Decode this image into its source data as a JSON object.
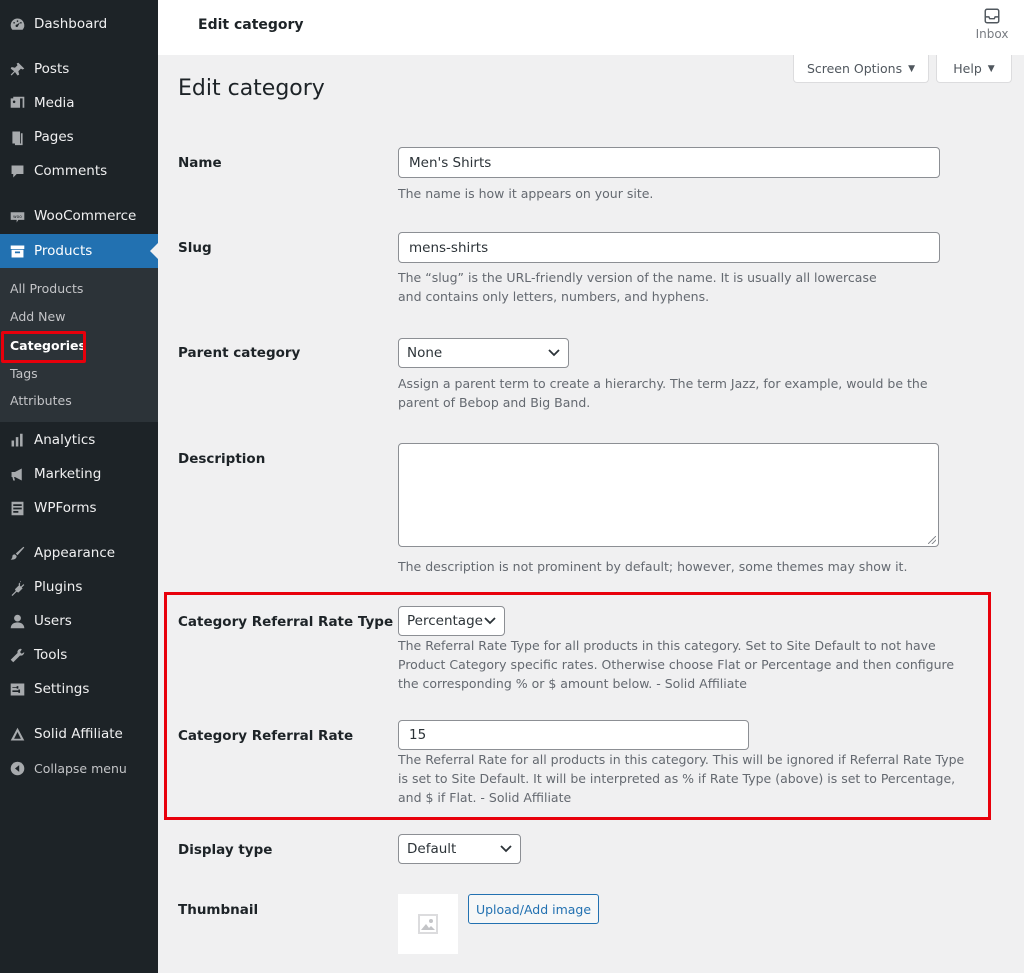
{
  "sidebar": {
    "menu": [
      {
        "label": "Dashboard",
        "icon": "dashboard-icon"
      },
      {
        "label": "Posts",
        "icon": "pin-icon"
      },
      {
        "label": "Media",
        "icon": "media-icon"
      },
      {
        "label": "Pages",
        "icon": "pages-icon"
      },
      {
        "label": "Comments",
        "icon": "comment-icon"
      },
      {
        "label": "WooCommerce",
        "icon": "woo-icon"
      },
      {
        "label": "Products",
        "icon": "archive-icon"
      },
      {
        "label": "Analytics",
        "icon": "chart-icon"
      },
      {
        "label": "Marketing",
        "icon": "megaphone-icon"
      },
      {
        "label": "WPForms",
        "icon": "form-icon"
      },
      {
        "label": "Appearance",
        "icon": "brush-icon"
      },
      {
        "label": "Plugins",
        "icon": "plug-icon"
      },
      {
        "label": "Users",
        "icon": "user-icon"
      },
      {
        "label": "Tools",
        "icon": "wrench-icon"
      },
      {
        "label": "Settings",
        "icon": "settings-icon"
      },
      {
        "label": "Solid Affiliate",
        "icon": "affiliate-icon"
      },
      {
        "label": "Collapse menu",
        "icon": "collapse-icon"
      }
    ],
    "submenu": [
      "All Products",
      "Add New",
      "Categories",
      "Tags",
      "Attributes"
    ]
  },
  "header": {
    "title": "Edit category",
    "inbox_label": "Inbox",
    "screen_options": "Screen Options",
    "help": "Help"
  },
  "main": {
    "title": "Edit category",
    "name": {
      "label": "Name",
      "value": "Men's Shirts",
      "help": "The name is how it appears on your site."
    },
    "slug": {
      "label": "Slug",
      "value": "mens-shirts",
      "help": "The “slug” is the URL-friendly version of the name. It is usually all lowercase and contains only letters, numbers, and hyphens."
    },
    "parent": {
      "label": "Parent category",
      "value": "None",
      "help": "Assign a parent term to create a hierarchy. The term Jazz, for example, would be the parent of Bebop and Big Band."
    },
    "description": {
      "label": "Description",
      "value": "",
      "help": "The description is not prominent by default; however, some themes may show it."
    },
    "rate_type": {
      "label": "Category Referral Rate Type",
      "value": "Percentage",
      "help": "The Referral Rate Type for all products in this category. Set to Site Default to not have Product Category specific rates. Otherwise choose Flat or Percentage and then configure the corresponding % or $ amount below. - Solid Affiliate"
    },
    "rate": {
      "label": "Category Referral Rate",
      "value": "15",
      "help": "The Referral Rate for all products in this category. This will be ignored if Referral Rate Type is set to Site Default. It will be interpreted as % if Rate Type (above) is set to Percentage, and $ if Flat. - Solid Affiliate"
    },
    "display_type": {
      "label": "Display type",
      "value": "Default"
    },
    "thumbnail": {
      "label": "Thumbnail",
      "button": "Upload/Add image"
    }
  },
  "colors": {
    "sidebar_bg": "#1d2327",
    "accent": "#2271b1",
    "highlight": "#e8000b"
  }
}
